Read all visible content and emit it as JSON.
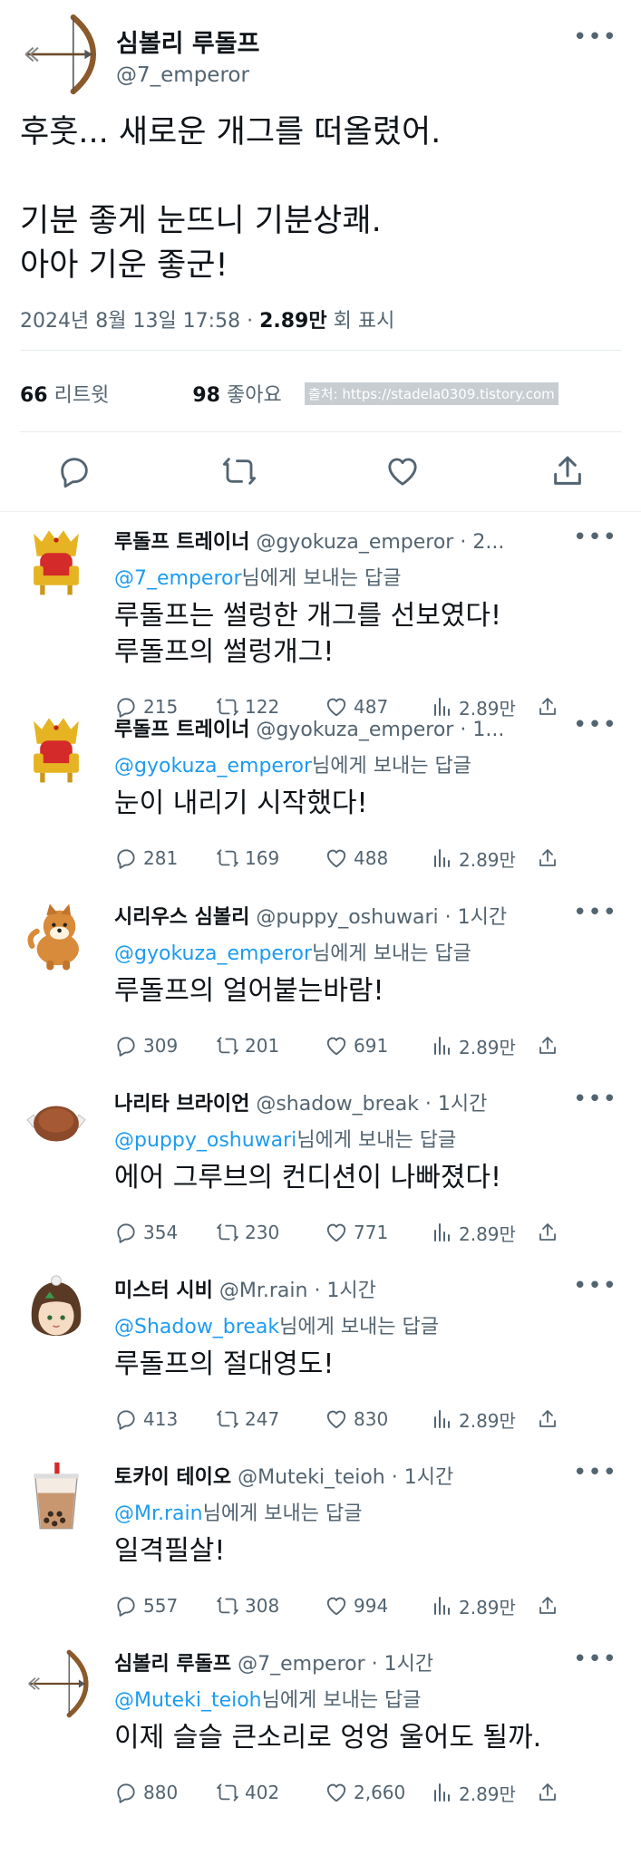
{
  "main_tweet": {
    "display_name": "심볼리 루돌프",
    "handle": "@7_emperor",
    "avatar_icon": "bow-and-arrow-icon",
    "text": "후훗... 새로운 개그를 떠올렸어.\n\n기분 좋게 눈뜨니 기분상쾌.\n아아 기운 좋군!",
    "datetime": "2024년 8월 13일  17:58 ·",
    "views": "2.89만",
    "views_label": "회 표시",
    "retweets": "66",
    "retweets_label": "리트윗",
    "likes": "98",
    "likes_label": "좋아요",
    "watermark": "출처: https://stadela0309.tistory.com"
  },
  "replies": [
    {
      "display_name": "루돌프 트레이너",
      "handle_time": "@gyokuza_emperor · 2...",
      "avatar_icon": "throne-icon",
      "reply_to": "@7_emperor",
      "reply_suffix": "님에게 보내는 답글",
      "text": "루돌프는 썰렁한 개그를 선보였다!\n루돌프의 썰렁개그!",
      "replies": "215",
      "retweets": "122",
      "likes": "487",
      "views": "2.89만"
    },
    {
      "display_name": "루돌프 트레이너",
      "handle_time": "@gyokuza_emperor · 1...",
      "avatar_icon": "throne-icon",
      "reply_to": "@gyokuza_emperor",
      "reply_suffix": "님에게 보내는 답글",
      "text": "눈이 내리기 시작했다!",
      "replies": "281",
      "retweets": "169",
      "likes": "488",
      "views": "2.89만"
    },
    {
      "display_name": "시리우스 심볼리",
      "handle_time": "@puppy_oshuwari · 1시간",
      "avatar_icon": "shiba-dog-icon",
      "reply_to": "@gyokuza_emperor",
      "reply_suffix": "님에게 보내는 답글",
      "text": "루돌프의 얼어붙는바람!",
      "replies": "309",
      "retweets": "201",
      "likes": "691",
      "views": "2.89만"
    },
    {
      "display_name": "나리타 브라이언",
      "handle_time": "@shadow_break · 1시간",
      "avatar_icon": "meat-icon",
      "reply_to": "@puppy_oshuwari",
      "reply_suffix": "님에게 보내는 답글",
      "text": "에어 그루브의 컨디션이 나빠졌다!",
      "replies": "354",
      "retweets": "230",
      "likes": "771",
      "views": "2.89만"
    },
    {
      "display_name": "미스터 시비",
      "handle_time": "@Mr.rain · 1시간",
      "avatar_icon": "horse-girl-icon",
      "reply_to": "@Shadow_break",
      "reply_suffix": "님에게 보내는 답글",
      "text": "루돌프의 절대영도!",
      "replies": "413",
      "retweets": "247",
      "likes": "830",
      "views": "2.89만"
    },
    {
      "display_name": "토카이 테이오",
      "handle_time": "@Muteki_teioh · 1시간",
      "avatar_icon": "bubble-tea-icon",
      "reply_to": "@Mr.rain",
      "reply_suffix": "님에게 보내는 답글",
      "text": "일격필살!",
      "replies": "557",
      "retweets": "308",
      "likes": "994",
      "views": "2.89만"
    },
    {
      "display_name": "심볼리 루돌프",
      "handle_time": "@7_emperor · 1시간",
      "avatar_icon": "bow-and-arrow-icon",
      "reply_to": "@Muteki_teioh",
      "reply_suffix": "님에게 보내는 답글",
      "text": "이제 슬슬 큰소리로 엉엉 울어도 될까.",
      "replies": "880",
      "retweets": "402",
      "likes": "2,660",
      "views": "2.89만"
    }
  ],
  "colors": {
    "link": "#1d9bf0",
    "muted": "#536471",
    "text": "#0f1419"
  }
}
